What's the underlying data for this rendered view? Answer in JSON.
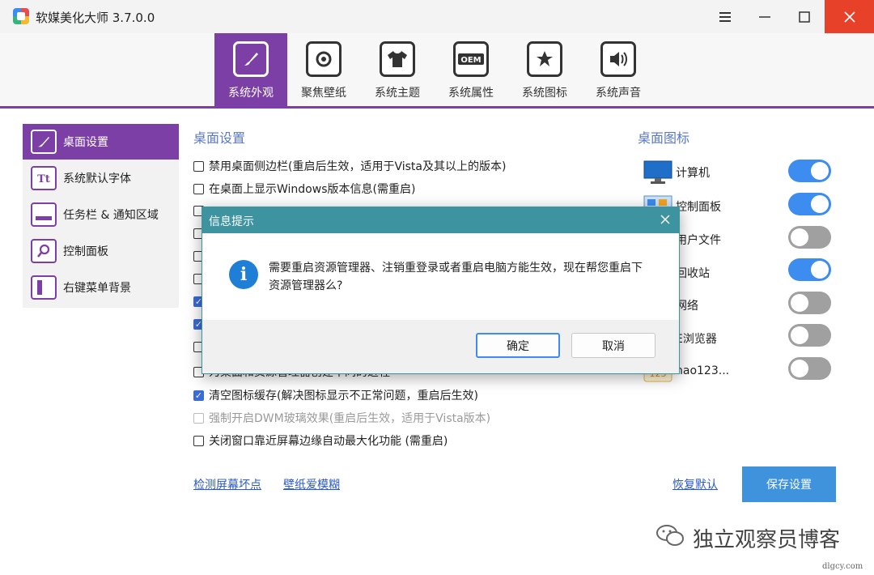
{
  "app": {
    "title": "软媒美化大师 3.7.0.0"
  },
  "tabs": [
    {
      "label": "系统外观",
      "icon": "brush-icon",
      "active": true
    },
    {
      "label": "聚焦壁纸",
      "icon": "camera-icon",
      "active": false
    },
    {
      "label": "系统主题",
      "icon": "tshirt-icon",
      "active": false
    },
    {
      "label": "系统属性",
      "icon": "oem-icon",
      "active": false
    },
    {
      "label": "系统图标",
      "icon": "star-icon",
      "active": false
    },
    {
      "label": "系统声音",
      "icon": "speaker-icon",
      "active": false
    }
  ],
  "sidebar": {
    "items": [
      {
        "label": "桌面设置",
        "icon": "desktop-brush-icon",
        "active": true
      },
      {
        "label": "系统默认字体",
        "icon": "font-icon"
      },
      {
        "label": "任务栏 & 通知区域",
        "icon": "taskbar-icon"
      },
      {
        "label": "控制面板",
        "icon": "magnifier-icon"
      },
      {
        "label": "右键菜单背景",
        "icon": "context-menu-icon"
      }
    ]
  },
  "main": {
    "title": "桌面设置",
    "options": [
      {
        "label": "禁用桌面侧边栏(重启后生效，适用于Vista及其以上的版本)",
        "checked": false,
        "disabled": false
      },
      {
        "label": "在桌面上显示Windows版本信息(需重启)",
        "checked": false,
        "disabled": false
      },
      {
        "label": "为桌面和资源管理器创建不同的进程",
        "checked": false,
        "disabled": false
      },
      {
        "label": "清空图标缓存(解决图标显示不正常问题，重启后生效)",
        "checked": true,
        "disabled": false
      },
      {
        "label": "强制开启DWM玻璃效果(重启后生效，适用于Vista版本)",
        "checked": false,
        "disabled": true
      },
      {
        "label": "关闭窗口靠近屏幕边缘自动最大化功能 (需重启)",
        "checked": false,
        "disabled": false
      }
    ],
    "hidden_checkbox_states": [
      false,
      false,
      false,
      false,
      true,
      true,
      false
    ],
    "links": {
      "detect": "检测屏幕坏点",
      "wallpaper": "壁纸爱模糊",
      "restore": "恢复默认"
    },
    "save_label": "保存设置"
  },
  "desktop_icons": {
    "title": "桌面图标",
    "items": [
      {
        "label": "计算机",
        "icon": "computer-icon",
        "on": true
      },
      {
        "label": "控制面板",
        "icon": "control-panel-icon",
        "on": true
      },
      {
        "label": "用户文件",
        "icon": "user-files-icon",
        "on": false
      },
      {
        "label": "回收站",
        "icon": "recycle-bin-icon",
        "on": true
      },
      {
        "label": "网络",
        "icon": "network-icon",
        "on": false
      },
      {
        "label": "E浏览器",
        "icon": "ie-icon",
        "on": false
      },
      {
        "label": "hao123...",
        "icon": "hao123-icon",
        "on": false
      }
    ]
  },
  "dialog": {
    "title": "信息提示",
    "message": "需要重启资源管理器、注销重登录或者重启电脑方能生效，现在帮您重启下资源管理器么?",
    "ok_label": "确定",
    "cancel_label": "取消"
  },
  "watermark": {
    "text": "独立观察员博客",
    "url": "dlgcy.com"
  },
  "colors": {
    "accent": "#7b3fa5",
    "link": "#2a59c8",
    "save": "#3f93dc",
    "dialog_header": "#3d93a0",
    "toggle_on": "#3d8cf0",
    "toggle_off": "#a0a0a0",
    "close": "#e8412a"
  }
}
